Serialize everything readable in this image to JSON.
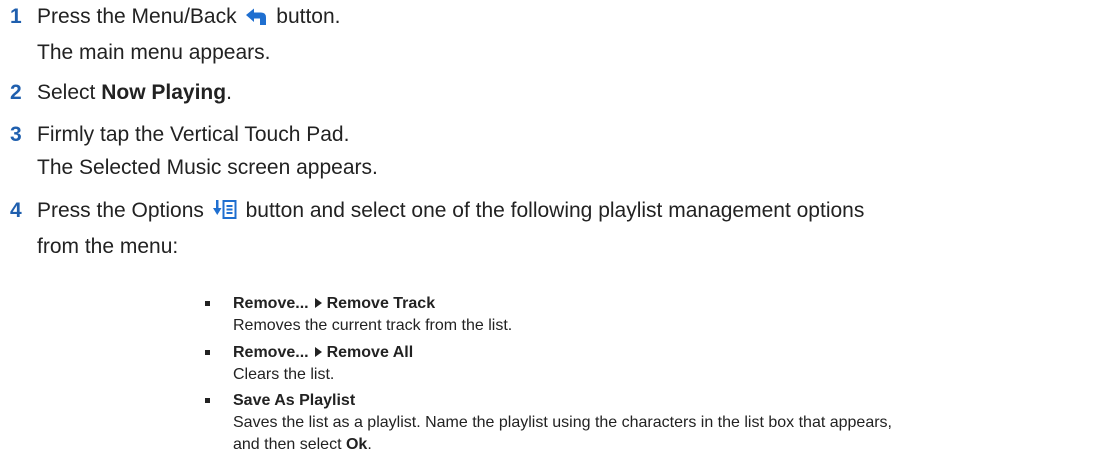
{
  "steps": [
    {
      "number": "1",
      "lines": [
        {
          "before_icon": "Press the Menu/Back",
          "icon": "back-arrow-icon",
          "after_icon": "button."
        },
        {
          "text": "The main menu appears."
        }
      ]
    },
    {
      "number": "2",
      "text_before": "Select ",
      "bold": "Now Playing",
      "text_after": "."
    },
    {
      "number": "3",
      "lines": [
        {
          "text": "Firmly tap the Vertical Touch Pad."
        },
        {
          "text": "The Selected Music screen appears."
        }
      ]
    },
    {
      "number": "4",
      "before_icon": "Press the Options",
      "icon": "options-icon",
      "after_icon": "button and select one of the following playlist management options",
      "line2": "from the menu:"
    }
  ],
  "options": [
    {
      "title_part1": "Remove...",
      "title_part2": "Remove Track",
      "description": "Removes the current track from the list."
    },
    {
      "title_part1": "Remove...",
      "title_part2": "Remove All",
      "description": "Clears the list."
    },
    {
      "title": "Save As Playlist",
      "description_line1": "Saves the list as a playlist. Name the playlist using the characters in the list box that appears,",
      "description_line2_before": "and then select ",
      "description_line2_bold": "Ok",
      "description_line2_after": "."
    }
  ],
  "colors": {
    "step_number": "#1f5fae",
    "icon": "#1f6fd0",
    "text": "#222222"
  }
}
